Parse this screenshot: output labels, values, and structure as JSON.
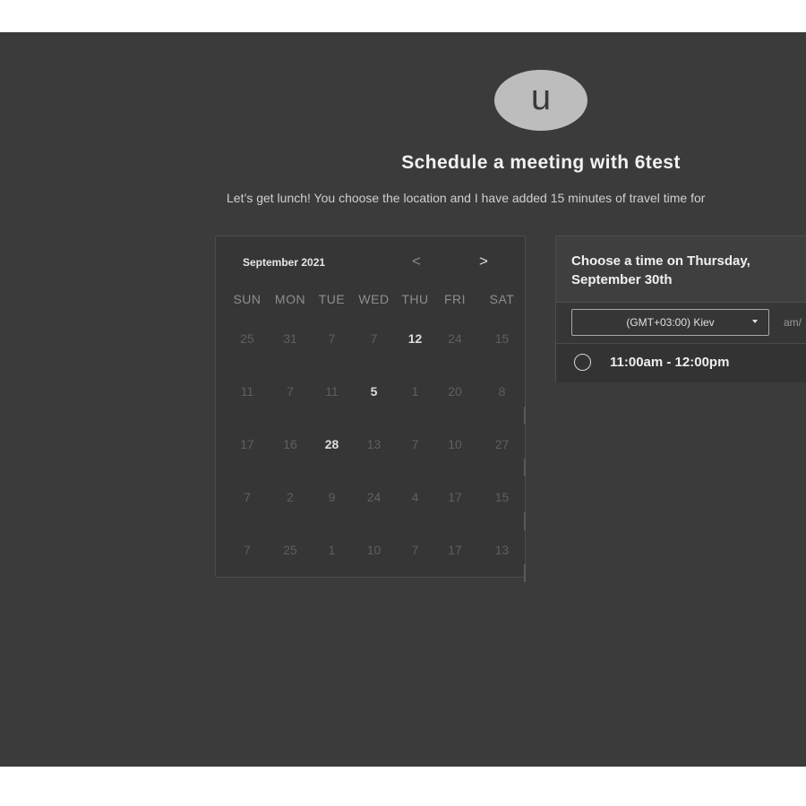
{
  "host": {
    "avatar_initial": "u",
    "title": "Schedule a meeting with 6test",
    "description": "Let’s get lunch! You choose the location and I have added 15 minutes of travel time for"
  },
  "calendar": {
    "month_label": "September 2021",
    "prev_icon": "chevron-left-icon",
    "next_icon": "chevron-right-icon",
    "prev_label": "<",
    "next_label": ">",
    "weekdays": [
      "SUN",
      "MON",
      "TUE",
      "WED",
      "THU",
      "FRI",
      "SAT"
    ],
    "weeks": [
      [
        "25",
        "31",
        "7",
        "7",
        "12",
        "24",
        "15"
      ],
      [
        "11",
        "7",
        "11",
        "5",
        "1",
        "20",
        "8"
      ],
      [
        "17",
        "16",
        "28",
        "13",
        "7",
        "10",
        "27"
      ],
      [
        "7",
        "2",
        "9",
        "24",
        "4",
        "17",
        "15"
      ],
      [
        "7",
        "25",
        "1",
        "10",
        "7",
        "17",
        "13"
      ]
    ],
    "available_days": [
      "12",
      "5",
      "28"
    ]
  },
  "time_panel": {
    "title": "Choose a time on Thursday, September 30th",
    "timezone": "(GMT+03:00) Kiev",
    "format_toggle": "am/",
    "slots": [
      "11:00am - 12:00pm"
    ]
  },
  "colors": {
    "background": "#3b3b3b",
    "panel": "#363636",
    "avatar": "#bdbdbd",
    "text_primary": "#f0f0f0",
    "text_muted": "#5f5f5f"
  }
}
